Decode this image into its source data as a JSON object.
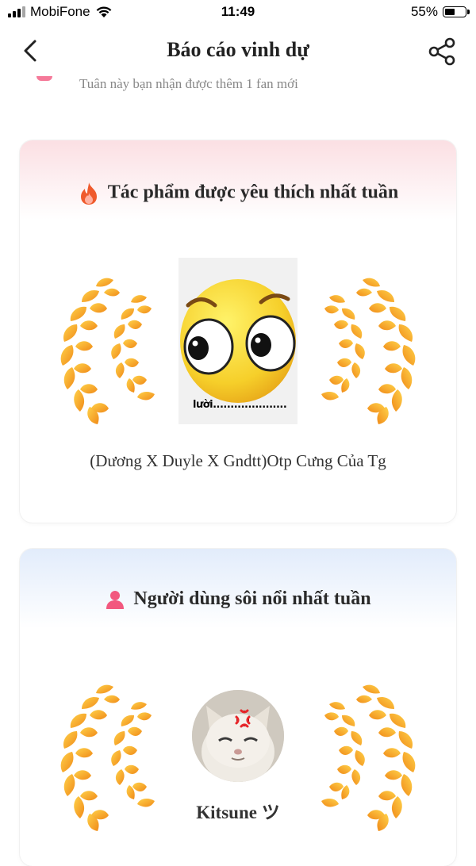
{
  "status_bar": {
    "carrier": "MobiFone",
    "time": "11:49",
    "battery": "55%",
    "battery_level": 0.55
  },
  "nav": {
    "title": "Báo cáo vinh dự"
  },
  "fans": {
    "text": "Tuân này bạn nhận được thêm 1 fan mới"
  },
  "favorite_work": {
    "heading": "Tác phẩm được yêu thích nhất tuần",
    "thumbnail_caption": "lười.....................",
    "work_title": "(Dương X Duyle X Gndtt)Otp Cưng Của Tg"
  },
  "active_user": {
    "heading": "Người dùng sôi nổi nhất tuần",
    "user_name": "Kitsune ツ"
  },
  "colors": {
    "accent_pink": "#f2587f",
    "laurel_gold": "#f7b21c",
    "laurel_orange": "#ef7a1d"
  }
}
